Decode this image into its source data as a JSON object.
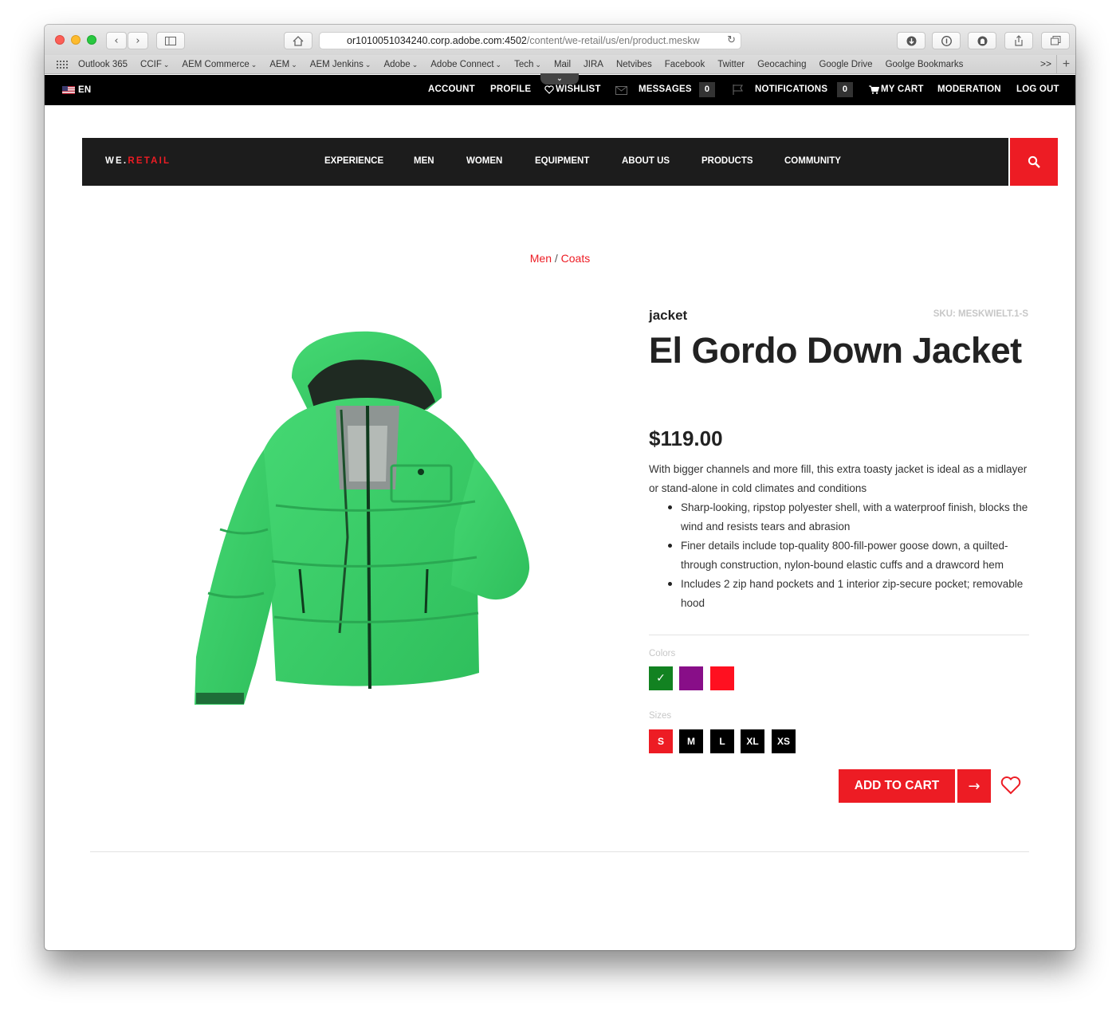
{
  "browser": {
    "url_host": "or1010051034240.corp.adobe.com:4502",
    "url_path": "/content/we-retail/us/en/product.meskw",
    "bookmarks": [
      {
        "label": "Outlook 365",
        "caret": ""
      },
      {
        "label": "CCIF",
        "caret": "⌄"
      },
      {
        "label": "AEM Commerce",
        "caret": "⌄"
      },
      {
        "label": "AEM",
        "caret": "⌄"
      },
      {
        "label": "AEM Jenkins",
        "caret": "⌄"
      },
      {
        "label": "Adobe",
        "caret": "⌄"
      },
      {
        "label": "Adobe Connect",
        "caret": "⌄"
      },
      {
        "label": "Tech",
        "caret": "⌄"
      },
      {
        "label": "Mail",
        "caret": ""
      },
      {
        "label": "JIRA",
        "caret": ""
      },
      {
        "label": "Netvibes",
        "caret": ""
      },
      {
        "label": "Facebook",
        "caret": ""
      },
      {
        "label": "Twitter",
        "caret": ""
      },
      {
        "label": "Geocaching",
        "caret": ""
      },
      {
        "label": "Google Drive",
        "caret": ""
      },
      {
        "label": "Goolge Bookmarks",
        "caret": ""
      }
    ],
    "more_label": ">>",
    "plus_label": "+"
  },
  "utility_bar": {
    "language": "EN",
    "account": "ACCOUNT",
    "profile": "PROFILE",
    "wishlist": "WISHLIST",
    "messages": "MESSAGES",
    "messages_count": "0",
    "notifications": "NOTIFICATIONS",
    "notifications_count": "0",
    "my_cart": "MY CART",
    "moderation": "MODERATION",
    "log_out": "LOG OUT"
  },
  "main_nav": {
    "logo_prefix": "WE.",
    "logo_suffix": "RETAIL",
    "links": [
      "EXPERIENCE",
      "MEN",
      "WOMEN",
      "EQUIPMENT",
      "ABOUT US",
      "PRODUCTS",
      "COMMUNITY"
    ]
  },
  "breadcrumb": {
    "items": [
      "Men",
      "Coats"
    ],
    "separator": " / "
  },
  "product": {
    "category": "jacket",
    "sku": "SKU: MESKWIELT.1-S",
    "title": "El Gordo Down Jacket",
    "price": "$119.00",
    "description": "With bigger channels and more fill, this extra toasty jacket is ideal as a midlayer or stand-alone in cold climates and conditions",
    "features": [
      "Sharp-looking, ripstop polyester shell, with a waterproof finish, blocks the wind and resists tears and abrasion",
      "Finer details include top-quality 800-fill-power goose down, a quilted-through construction, nylon-bound elastic cuffs and a drawcord hem",
      "Includes 2 zip hand pockets and 1 interior zip-secure pocket; removable hood"
    ],
    "colors_label": "Colors",
    "colors": [
      {
        "hex": "#128221",
        "selected": true
      },
      {
        "hex": "#880e88",
        "selected": false
      },
      {
        "hex": "#ff1020",
        "selected": false
      }
    ],
    "color_check": "✓",
    "sizes_label": "Sizes",
    "sizes": [
      "S",
      "M",
      "L",
      "XL",
      "XS"
    ],
    "selected_size": "S",
    "add_to_cart": "ADD TO CART",
    "image_icon": "green-down-jacket"
  },
  "theme": {
    "accent": "#ed1c24",
    "nav_bg": "#1c1c1c",
    "utility_bg": "#000000",
    "jacket_green": "#3ecf6e"
  }
}
